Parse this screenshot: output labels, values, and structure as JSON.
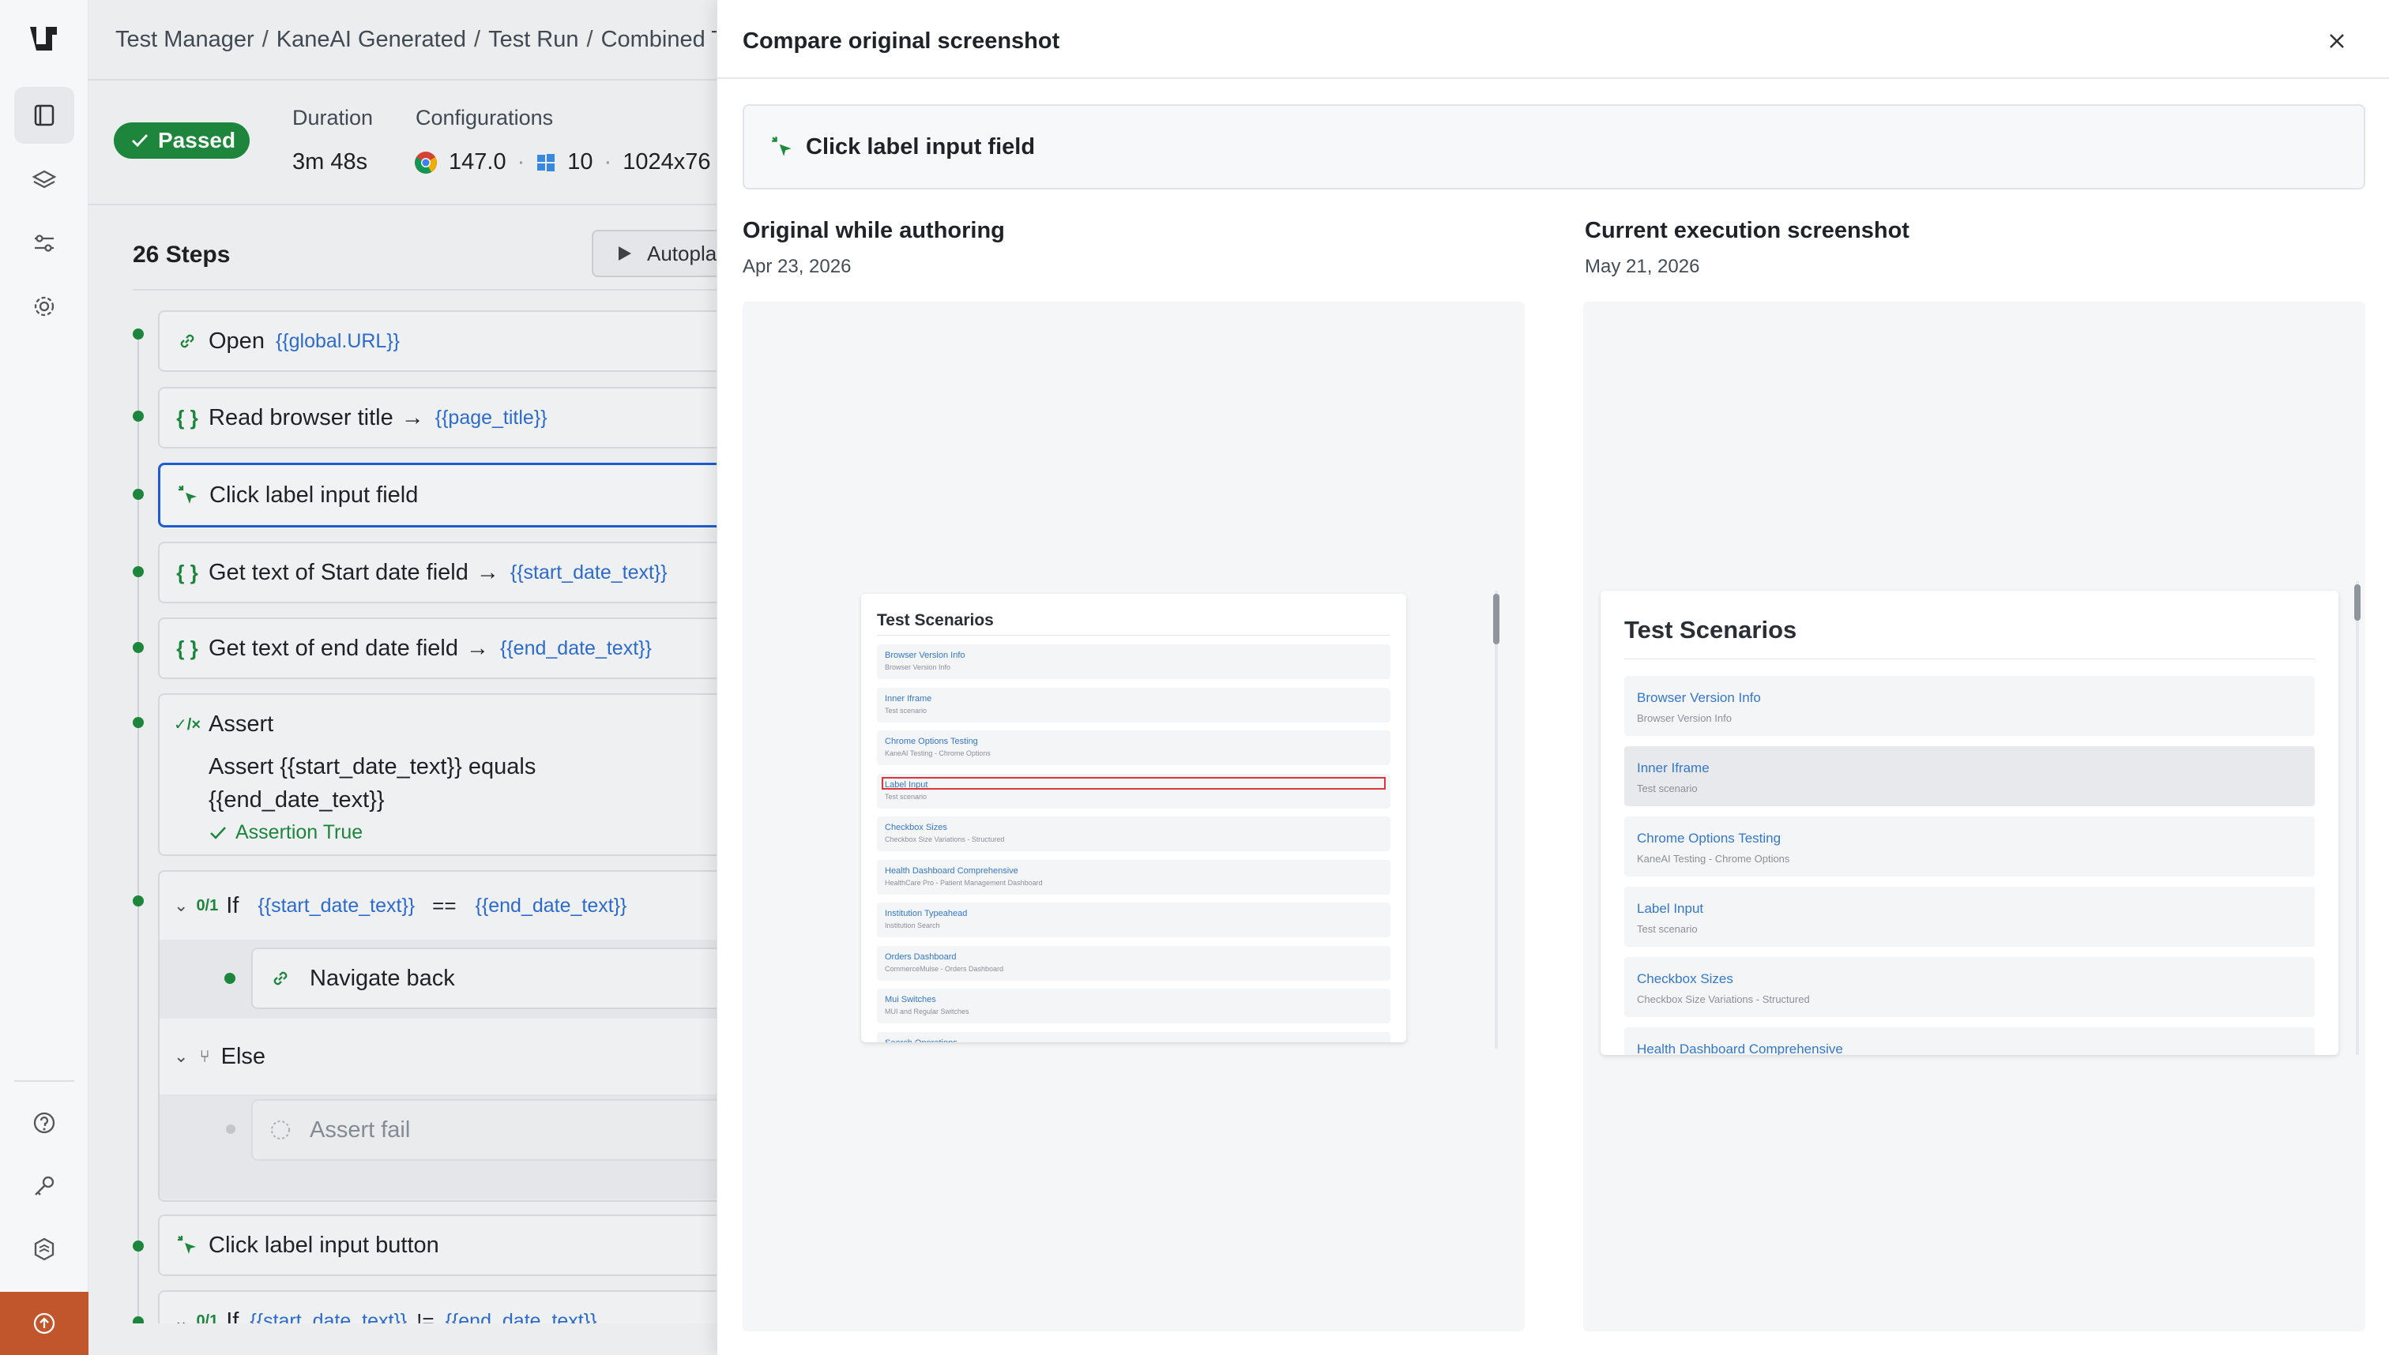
{
  "breadcrumb": {
    "items": [
      "Test Manager",
      "KaneAI Generated",
      "Test Run",
      "Combined T"
    ],
    "separator": "/"
  },
  "run": {
    "status": "Passed",
    "duration_label": "Duration",
    "duration_value": "3m 48s",
    "configurations_label": "Configurations",
    "browser_version": "147.0",
    "os_version": "10",
    "resolution": "1024x76"
  },
  "steps_header": {
    "count_label": "26 Steps",
    "autoplay_label": "Autopla"
  },
  "steps": [
    {
      "label": "Open",
      "var": "{{global.URL}}"
    },
    {
      "label": "Read browser title",
      "var": "{{page_title}}"
    },
    {
      "label": "Click label input field"
    },
    {
      "label": "Get text of Start date field",
      "var": "{{start_date_text}}"
    },
    {
      "label": "Get text of end date field",
      "var": "{{end_date_text}}"
    },
    {
      "label": "Assert",
      "line1": "Assert {{start_date_text}} equals",
      "line2": "{{end_date_text}}",
      "result": "Assertion True"
    },
    {
      "label": "If",
      "counter": "0/1",
      "var1": "{{start_date_text}}",
      "op": "==",
      "var2": "{{end_date_text}}"
    },
    {
      "label": "Navigate back"
    },
    {
      "label": "Else"
    },
    {
      "label": "Assert fail"
    },
    {
      "label": "Click label input button"
    },
    {
      "label": "If",
      "counter": "0/1",
      "var1": "{{start_date_text}}",
      "op": "!=",
      "var2": "{{end_date_text}}"
    }
  ],
  "panel": {
    "title": "Compare original screenshot",
    "step_label": "Click label input field",
    "original": {
      "title": "Original while authoring",
      "date": "Apr 23, 2026"
    },
    "current": {
      "title": "Current execution screenshot",
      "date": "May 21, 2026"
    }
  },
  "mini_screenshot": {
    "title": "Test Scenarios",
    "items": [
      {
        "name": "Browser Version Info",
        "sub": "Browser Version Info"
      },
      {
        "name": "Inner Iframe",
        "sub": "Test scenario"
      },
      {
        "name": "Chrome Options Testing",
        "sub": "KaneAI Testing - Chrome Options"
      },
      {
        "name": "Label Input",
        "sub": "Test scenario"
      },
      {
        "name": "Checkbox Sizes",
        "sub": "Checkbox Size Variations - Structured"
      },
      {
        "name": "Health Dashboard Comprehensive",
        "sub": "HealthCare Pro - Patient Management Dashboard"
      },
      {
        "name": "Institution Typeahead",
        "sub": "Institution Search"
      },
      {
        "name": "Orders Dashboard",
        "sub": "CommerceMulse - Orders Dashboard"
      },
      {
        "name": "Mui Switches",
        "sub": "MUI and Regular Switches"
      },
      {
        "name": "Search Operations",
        "sub": ""
      }
    ]
  },
  "colors": {
    "accent": "#1f5fd6",
    "passed": "#1f8a3e",
    "variable": "#2f6fd1",
    "highlight": "#e0343a",
    "upgrade": "#c1552b"
  }
}
